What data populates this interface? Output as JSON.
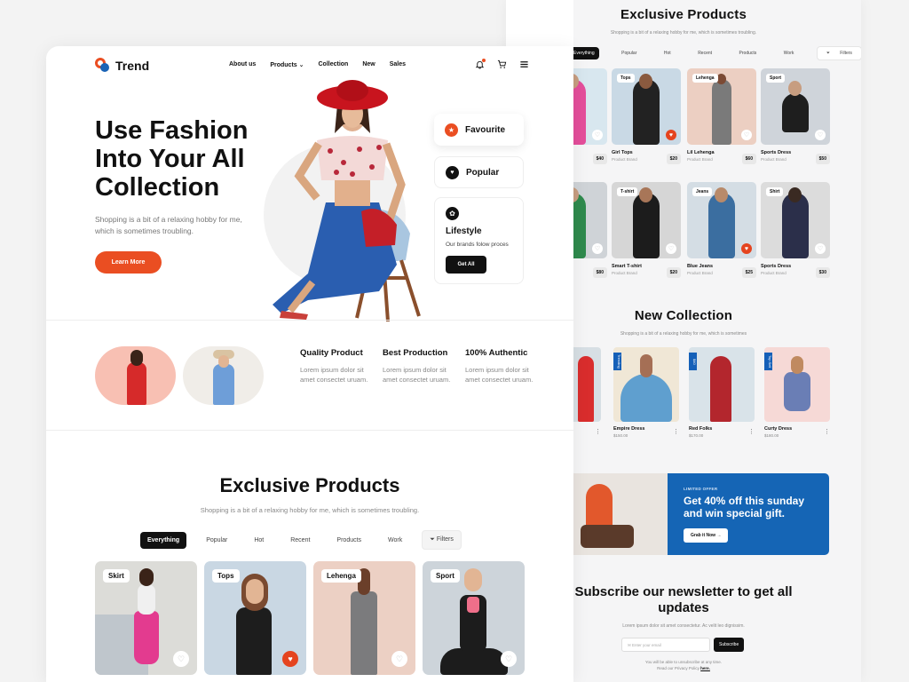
{
  "brand": {
    "name": "Trend"
  },
  "nav": {
    "about": "About us",
    "products": "Products",
    "collection": "Collection",
    "new": "New",
    "sales": "Sales"
  },
  "icons": {
    "bell": "bell-icon",
    "cart": "cart-icon",
    "menu": "menu-icon",
    "chevron": "chevron-down-icon"
  },
  "hero": {
    "title": "Use Fashion Into Your All Collection",
    "subtitle": "Shopping is a bit of a relaxing hobby for me, which is sometimes troubling.",
    "cta": "Learn More"
  },
  "side_cards": {
    "favourite": "Favourite",
    "popular": "Popular",
    "lifestyle_title": "Lifestyle",
    "lifestyle_desc": "Our brands folow proces",
    "lifestyle_btn": "Get All"
  },
  "features": [
    {
      "title": "Quality Product",
      "desc": "Lorem ipsum dolor sit amet consectet uruam."
    },
    {
      "title": "Best Production",
      "desc": "Lorem ipsum dolor sit amet consectet uruam."
    },
    {
      "title": "100% Authentic",
      "desc": "Lorem ipsum dolor sit amet consectet uruam."
    }
  ],
  "exclusive": {
    "title": "Exclusive Products",
    "subtitle": "Shopping is a bit of a relaxing hobby for me, which is sometimes troubling.",
    "subtitle_short": "Shopping is a bit of a relaxing hobby for me, which is sometimes troubling."
  },
  "filters": [
    "Everything",
    "Popular",
    "Hot",
    "Recent",
    "Products",
    "Work"
  ],
  "filters_btn": "Filters",
  "main_cards": [
    {
      "tag": "Skirt"
    },
    {
      "tag": "Tops"
    },
    {
      "tag": "Lehenga"
    },
    {
      "tag": "Sport"
    }
  ],
  "back_products": [
    {
      "tag": "",
      "name": "",
      "brand": "",
      "price": "$40"
    },
    {
      "tag": "Tops",
      "name": "Girl Tops",
      "brand": "Product Brand",
      "price": "$20"
    },
    {
      "tag": "Lehenga",
      "name": "Lil Lehenga",
      "brand": "Product Brand",
      "price": "$60"
    },
    {
      "tag": "Sport",
      "name": "Sports Dress",
      "brand": "Product Brand",
      "price": "$50"
    },
    {
      "tag": "",
      "name": "",
      "brand": "",
      "price": "$80"
    },
    {
      "tag": "T-shirt",
      "name": "Smart T-shirt",
      "brand": "Product Brand",
      "price": "$20"
    },
    {
      "tag": "Jeans",
      "name": "Blue Jeans",
      "brand": "Product Brand",
      "price": "$25"
    },
    {
      "tag": "Shirt",
      "name": "Sports Dress",
      "brand": "Product Brand",
      "price": "$30"
    }
  ],
  "new_collection": {
    "title": "New Collection",
    "subtitle": "Shopping is a bit of a relaxing hobby for me, which is sometimes",
    "items": [
      {
        "tag": "",
        "name": "es",
        "price": ""
      },
      {
        "tag": "Trending",
        "name": "Empire Dress",
        "price": "$150.00"
      },
      {
        "tag": "$40",
        "name": "Red Folks",
        "price": "$170.00"
      },
      {
        "tag": "Top Sell",
        "name": "Curty Dress",
        "price": "$180.00"
      }
    ]
  },
  "offer": {
    "label": "LIMITED OFFER",
    "title": "Get 40% off this sunday and win special gift.",
    "btn": "Grab it Now →"
  },
  "newsletter": {
    "title": "Subscribe our newsletter to get all updates",
    "subtitle": "Lorem ipsum dolor sit amet consectetur. Ac velit leo dignissim.",
    "placeholder": "Enter your email",
    "btn": "Subscribe",
    "foot1": "You will be able to unsubscribe at any time.",
    "foot2": "Read our Privacy Policy",
    "foot_link": "here."
  },
  "colors": {
    "accent": "#ea4e22",
    "blue": "#1565b5",
    "dark": "#111111"
  }
}
